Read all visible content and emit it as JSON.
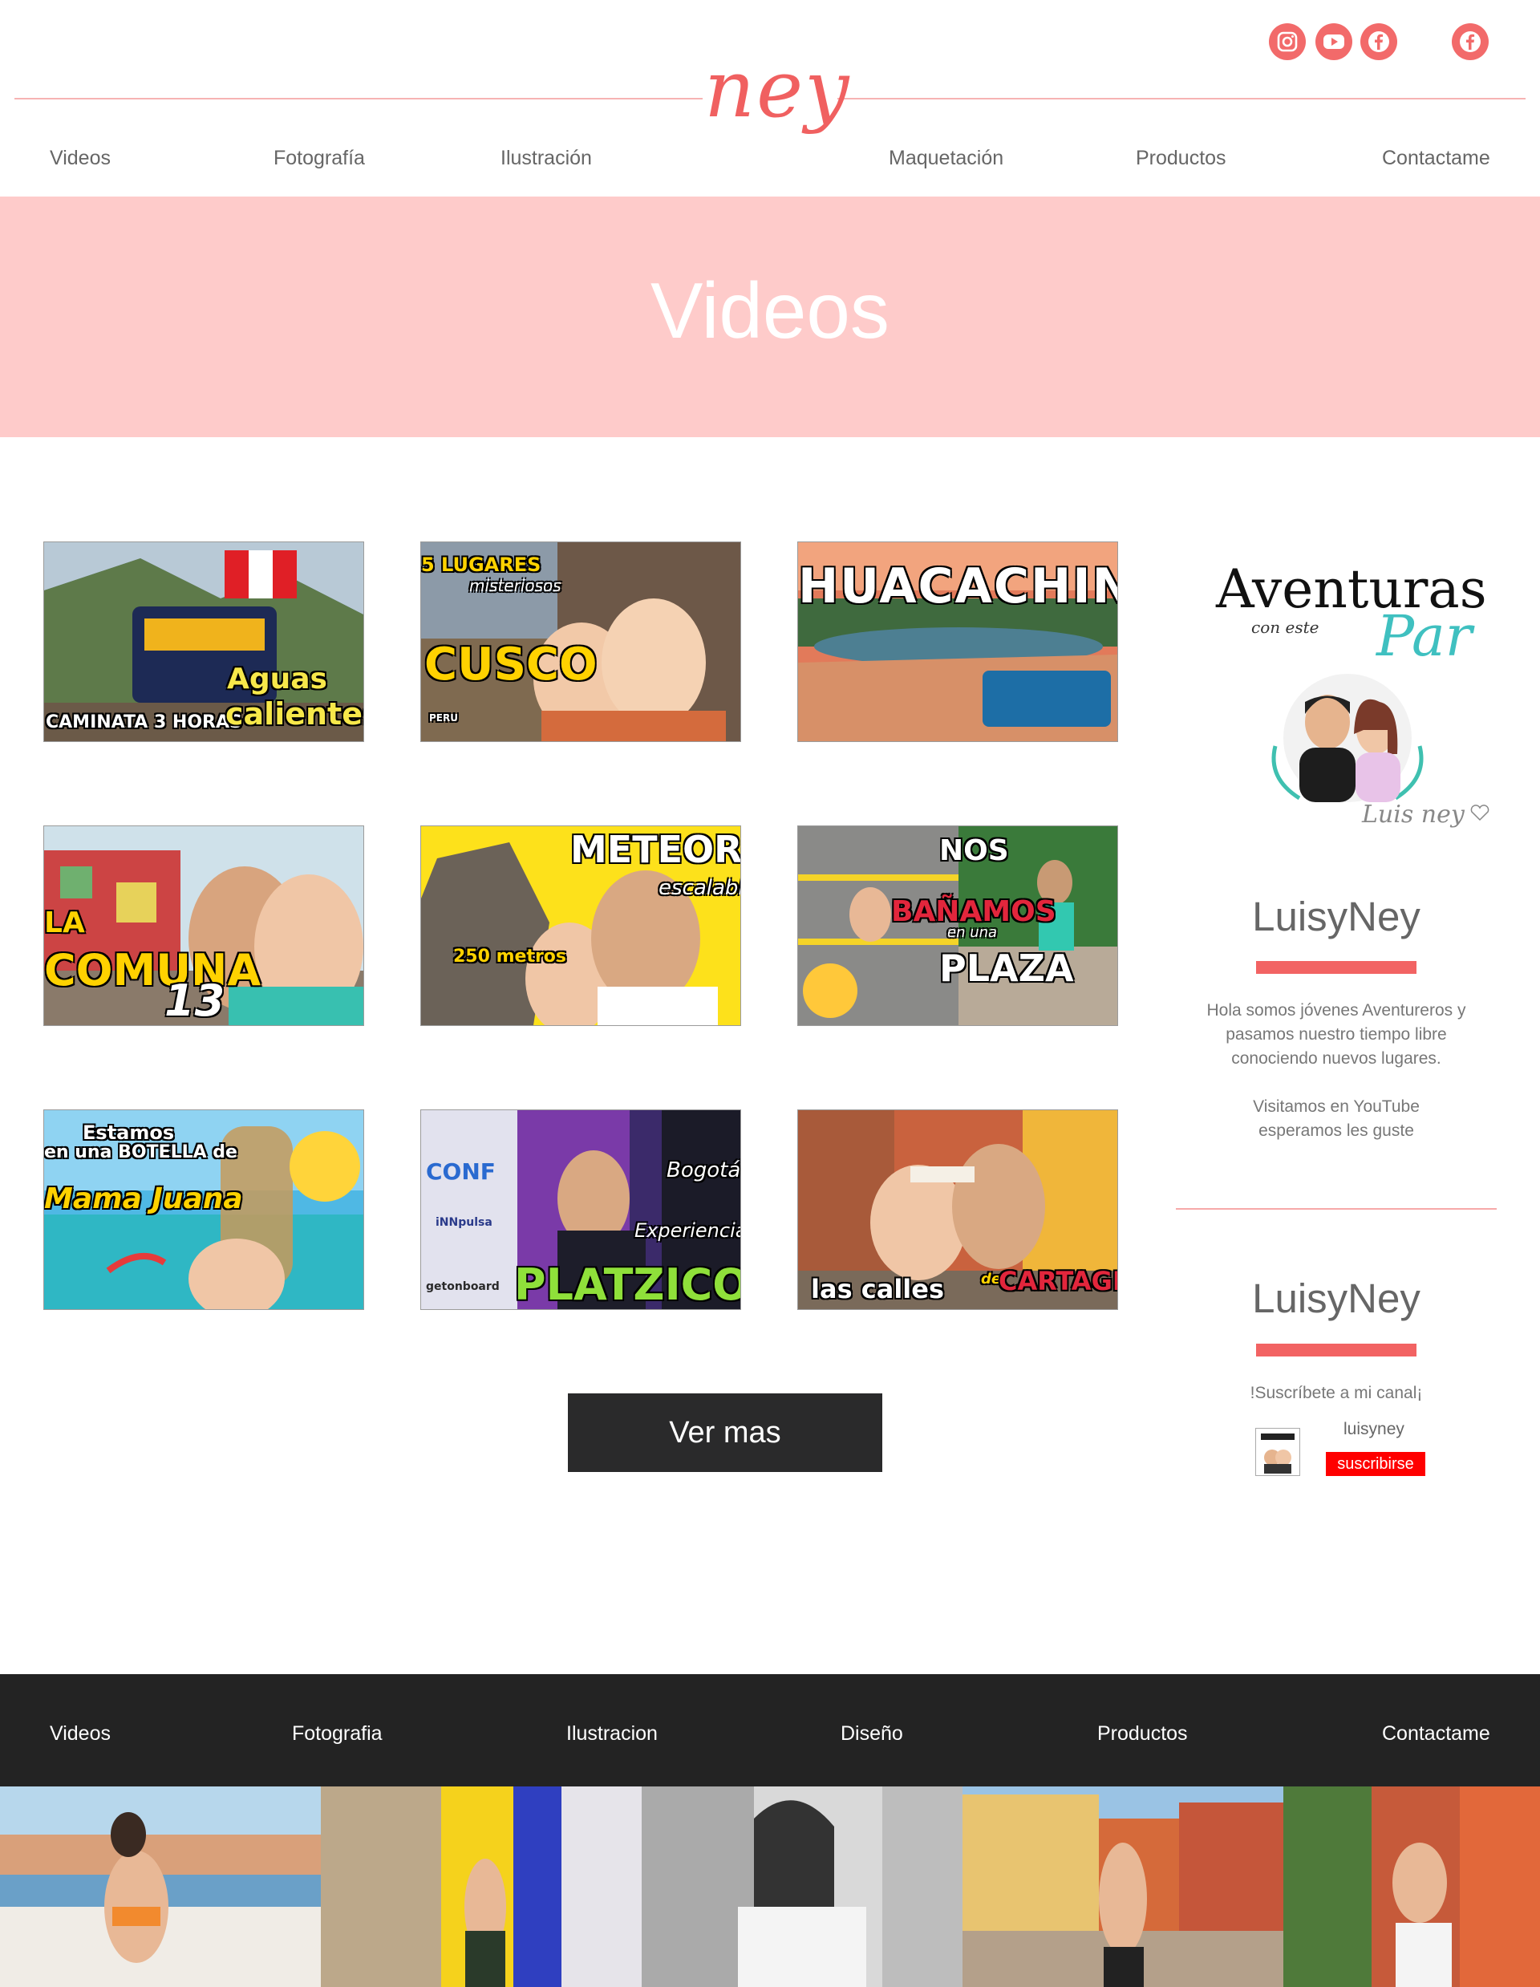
{
  "header": {
    "logo_text": "ney",
    "social_icons": [
      "instagram-icon",
      "youtube-icon",
      "facebook-icon",
      "facebook-icon"
    ],
    "brand_color": "#f26a6a",
    "nav": [
      "Videos",
      "Fotografía",
      "Ilustración",
      "Maquetación",
      "Productos",
      "Contactame"
    ]
  },
  "banner": {
    "title": "Videos",
    "background": "#fecbca"
  },
  "videos": [
    {
      "lines": [
        "CAMINATA 3 HORAS",
        "Aguas",
        "calientes"
      ]
    },
    {
      "lines": [
        "5 LUGARES",
        "misteriosos",
        "CUSCO",
        "PERU"
      ]
    },
    {
      "lines": [
        "HUACACHINA"
      ]
    },
    {
      "lines": [
        "LA",
        "COMUNA",
        "13"
      ]
    },
    {
      "lines": [
        "METEORITO",
        "escalable",
        "250 metros"
      ]
    },
    {
      "lines": [
        "NOS",
        "BAÑAMOS",
        "en una",
        "PLAZA"
      ]
    },
    {
      "lines": [
        "Estamos",
        "en una BOTELLA de",
        "Mama Juana"
      ]
    },
    {
      "lines": [
        "Bogotá",
        "Experiencia",
        "PLATZICONF",
        "CONF",
        "iNNpulsa",
        "getonboard"
      ]
    },
    {
      "lines": [
        "las calles",
        "de",
        "CARTAGENA"
      ]
    }
  ],
  "more_button": "Ver mas",
  "sidebar": {
    "logo": {
      "line1": "Aventuras",
      "line2": "con este",
      "line3": "Par",
      "signature": "Luis ney"
    },
    "title": "LuisyNey",
    "about_1": "Hola somos jóvenes Aventureros y pasamos nuestro tiempo libre conociendo nuevos lugares.",
    "about_2": "Visitamos en YouTube esperamos les guste",
    "title_2": "LuisyNey",
    "subscribe_text": "!Suscríbete a mi canal¡",
    "channel_name": "luisyney",
    "subscribe_button": "suscribirse",
    "subscribe_color": "#ff0000"
  },
  "footer": {
    "nav": [
      "Videos",
      "Fotografia",
      "Ilustracion",
      "Diseño",
      "Productos",
      "Contactame"
    ],
    "background": "#232323"
  }
}
